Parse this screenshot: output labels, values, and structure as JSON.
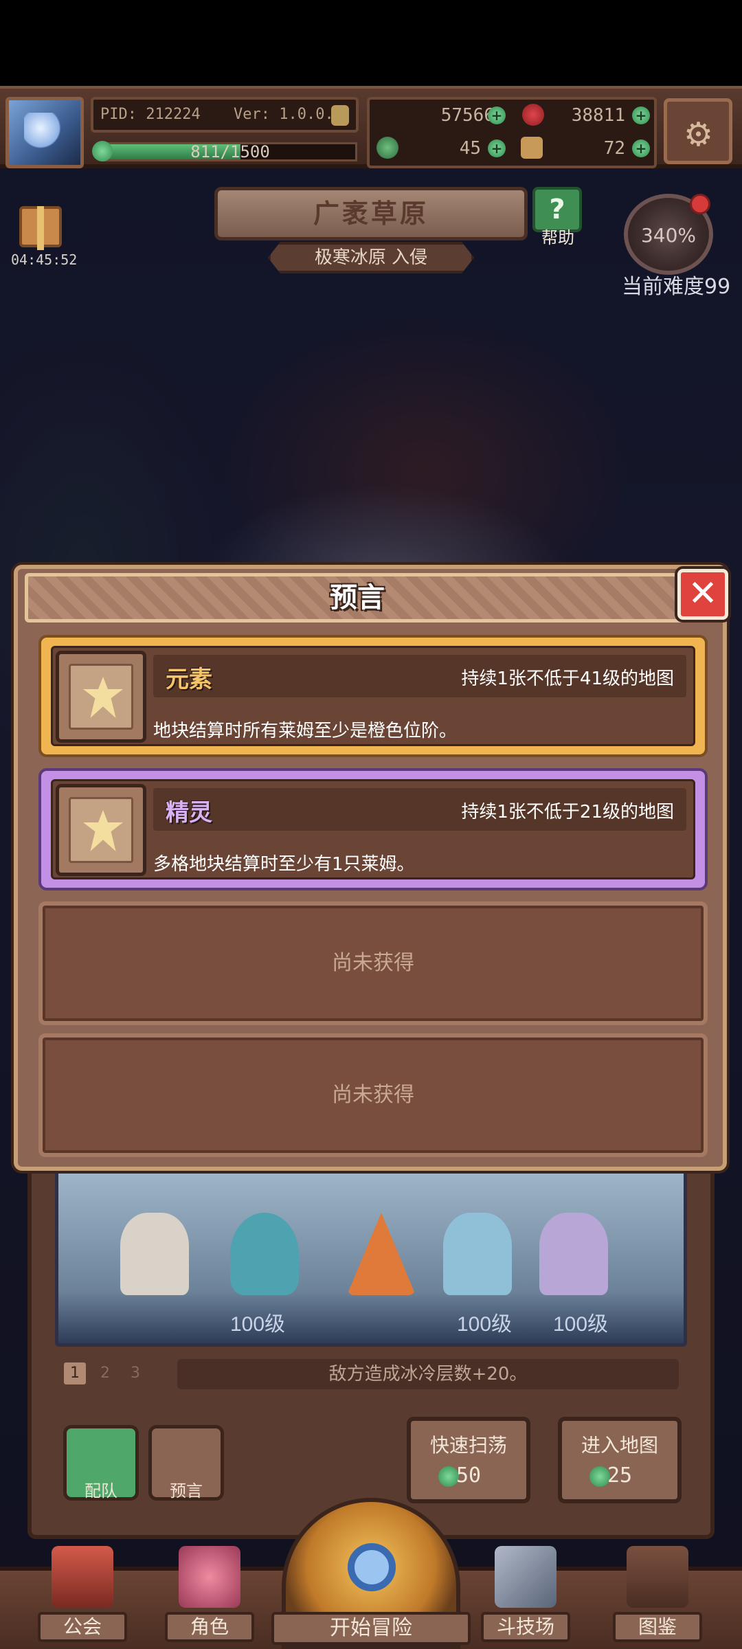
{
  "topbar": {
    "pid": "PID: 212224",
    "version": "Ver: 1.0.0.8",
    "exp": "811/1500",
    "exp_fraction": 0.54,
    "resource_gold": "57566",
    "resource_red": "38811",
    "resource_clover": "45",
    "resource_key": "72"
  },
  "area": {
    "title": "广袤草原",
    "invasion": "极寒冰原 入侵",
    "help_label": "帮助",
    "gift_timer": "04:45:52",
    "difficulty_pct": "340%",
    "difficulty_label": "当前难度99"
  },
  "stage": {
    "level_1": "100级",
    "level_2": "100级",
    "level_3": "100级",
    "pages": [
      "1",
      "2",
      "3"
    ],
    "effect": "敌方造成冰冷层数+20。",
    "team_label": "配队",
    "prophecy_label": "预言",
    "sweep_label": "快速扫荡",
    "sweep_cost": "50",
    "enter_label": "进入地图",
    "enter_cost": "25"
  },
  "nav": {
    "guild": "公会",
    "character": "角色",
    "start": "开始冒险",
    "arena": "斗技场",
    "codex": "图鉴"
  },
  "modal": {
    "title": "预言",
    "close_icon": "close-icon",
    "cards": [
      {
        "name": "元素",
        "requirement": "持续1张不低于41级的地图",
        "description": "地块结算时所有莱姆至少是橙色位阶。",
        "rarity_color": "#f0b550",
        "name_color": "#f5c46a"
      },
      {
        "name": "精灵",
        "requirement": "持续1张不低于21级的地图",
        "description": "多格地块结算时至少有1只莱姆。",
        "rarity_color": "#c490e6",
        "name_color": "#d9b2f5"
      }
    ],
    "empty_slots": [
      "尚未获得",
      "尚未获得"
    ]
  }
}
